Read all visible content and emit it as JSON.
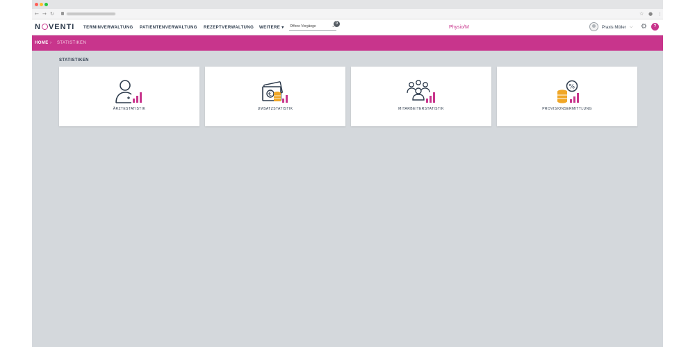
{
  "header": {
    "logo": "NOVENTI",
    "nav": [
      "TERMINVERWALTUNG",
      "PATIENTENVERWALTUNG",
      "REZEPTVERWALTUNG",
      "WEITERE"
    ],
    "dropdown": {
      "label": "Offene Vorgänge",
      "badge": "0"
    },
    "center_title": "Physio/M",
    "user_name": "Praxis Müller",
    "help_label": "?"
  },
  "breadcrumb": {
    "home": "HOME",
    "separator": "›",
    "current": "STATISTIKEN"
  },
  "main": {
    "title": "STATISTIKEN",
    "cards": [
      {
        "label": "ÄRZTESTATISTIK",
        "icon": "doctor-statistics-icon"
      },
      {
        "label": "UMSATZSTATISTIK",
        "icon": "revenue-statistics-icon"
      },
      {
        "label": "MITARBEITERSTATISTIK",
        "icon": "employee-statistics-icon"
      },
      {
        "label": "PROVISIONSERMITTLUNG",
        "icon": "commission-calculation-icon"
      }
    ]
  },
  "colors": {
    "accent": "#c8358c",
    "dark": "#2c3a4b",
    "gold": "#f0a727",
    "background": "#d4d8dc"
  }
}
